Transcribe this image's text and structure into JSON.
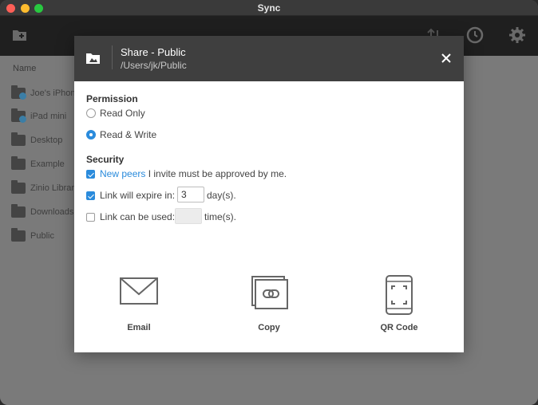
{
  "window": {
    "title": "Sync"
  },
  "list": {
    "header": "Name",
    "rows": [
      {
        "label": "Joe's iPhone",
        "badge": true
      },
      {
        "label": "iPad mini",
        "badge": true
      },
      {
        "label": "Desktop",
        "badge": false
      },
      {
        "label": "Example",
        "badge": false
      },
      {
        "label": "Zinio Library",
        "badge": false
      },
      {
        "label": "Downloads",
        "badge": false
      },
      {
        "label": "Public",
        "badge": false
      }
    ]
  },
  "dialog": {
    "title": "Share - Public",
    "path": "/Users/jk/Public",
    "permission": {
      "heading": "Permission",
      "options": [
        {
          "label": "Read Only",
          "selected": false
        },
        {
          "label": "Read & Write",
          "selected": true
        }
      ]
    },
    "security": {
      "heading": "Security",
      "approve": {
        "checked": true,
        "link_text": "New peers",
        "rest_text": " I invite must be approved by me."
      },
      "expire": {
        "checked": true,
        "label": "Link will expire in:",
        "value": "3",
        "suffix": "day(s)."
      },
      "uses": {
        "checked": false,
        "label": "Link can be used:",
        "value": "",
        "suffix": "time(s)."
      }
    },
    "actions": {
      "email": "Email",
      "copy": "Copy",
      "qr": "QR Code"
    }
  },
  "colors": {
    "accent": "#2a8bdc",
    "header_bg": "#3f3f3f",
    "toolbar_bg": "#1f1f1f"
  }
}
